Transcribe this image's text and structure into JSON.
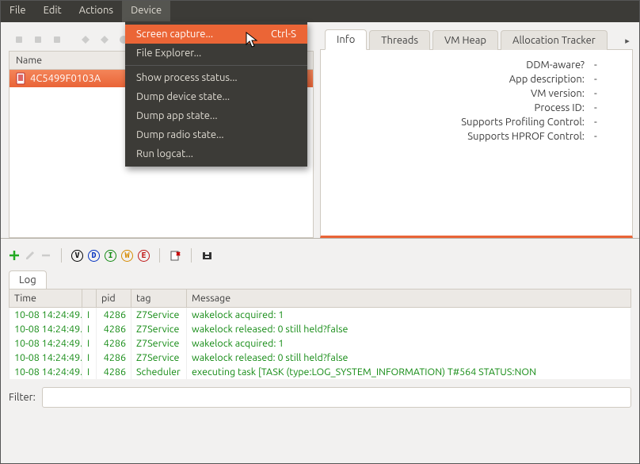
{
  "menubar": {
    "items": [
      "File",
      "Edit",
      "Actions",
      "Device"
    ],
    "active_index": 3
  },
  "dropdown": {
    "items": [
      {
        "label": "Screen capture...",
        "accel": "Ctrl-S",
        "highlight": true
      },
      {
        "label": "File Explorer..."
      },
      {
        "sep": true
      },
      {
        "label": "Show process status..."
      },
      {
        "label": "Dump device state..."
      },
      {
        "label": "Dump app state..."
      },
      {
        "label": "Dump radio state..."
      },
      {
        "label": "Run logcat..."
      }
    ]
  },
  "left": {
    "column_header": "Name",
    "device_id": "4C5499F0103A"
  },
  "right": {
    "tabs": [
      "Info",
      "Threads",
      "VM Heap",
      "Allocation Tracker"
    ],
    "active_index": 0,
    "info_rows": [
      {
        "k": "DDM-aware?",
        "v": "-"
      },
      {
        "k": "App description:",
        "v": "-"
      },
      {
        "k": "VM version:",
        "v": "-"
      },
      {
        "k": "Process ID:",
        "v": "-"
      },
      {
        "k": "Supports Profiling Control:",
        "v": "-"
      },
      {
        "k": "Supports HPROF Control:",
        "v": "-"
      }
    ]
  },
  "log_toolbar": {
    "levels": [
      {
        "letter": "V",
        "color": "#000000"
      },
      {
        "letter": "D",
        "color": "#0030c0"
      },
      {
        "letter": "I",
        "color": "#128a12"
      },
      {
        "letter": "W",
        "color": "#d68b00"
      },
      {
        "letter": "E",
        "color": "#c01818"
      }
    ]
  },
  "log_tabs": [
    "Log"
  ],
  "log_columns": [
    "Time",
    "",
    "pid",
    "tag",
    "Message"
  ],
  "log_rows": [
    {
      "time": "10-08 14:24:49.",
      "lvl": "I",
      "pid": "4286",
      "tag": "Z7Service",
      "msg": "wakelock acquired: 1"
    },
    {
      "time": "10-08 14:24:49.",
      "lvl": "I",
      "pid": "4286",
      "tag": "Z7Service",
      "msg": "wakelock released: 0 still held?false"
    },
    {
      "time": "10-08 14:24:49.",
      "lvl": "I",
      "pid": "4286",
      "tag": "Z7Service",
      "msg": "wakelock acquired: 1"
    },
    {
      "time": "10-08 14:24:49.",
      "lvl": "I",
      "pid": "4286",
      "tag": "Z7Service",
      "msg": "wakelock released: 0 still held?false"
    },
    {
      "time": "10-08 14:24:49.",
      "lvl": "I",
      "pid": "4286",
      "tag": "Scheduler",
      "msg": "executing task [TASK (type:LOG_SYSTEM_INFORMATION) T#564 STATUS:NON"
    }
  ],
  "filter_label": "Filter:",
  "filter_value": ""
}
